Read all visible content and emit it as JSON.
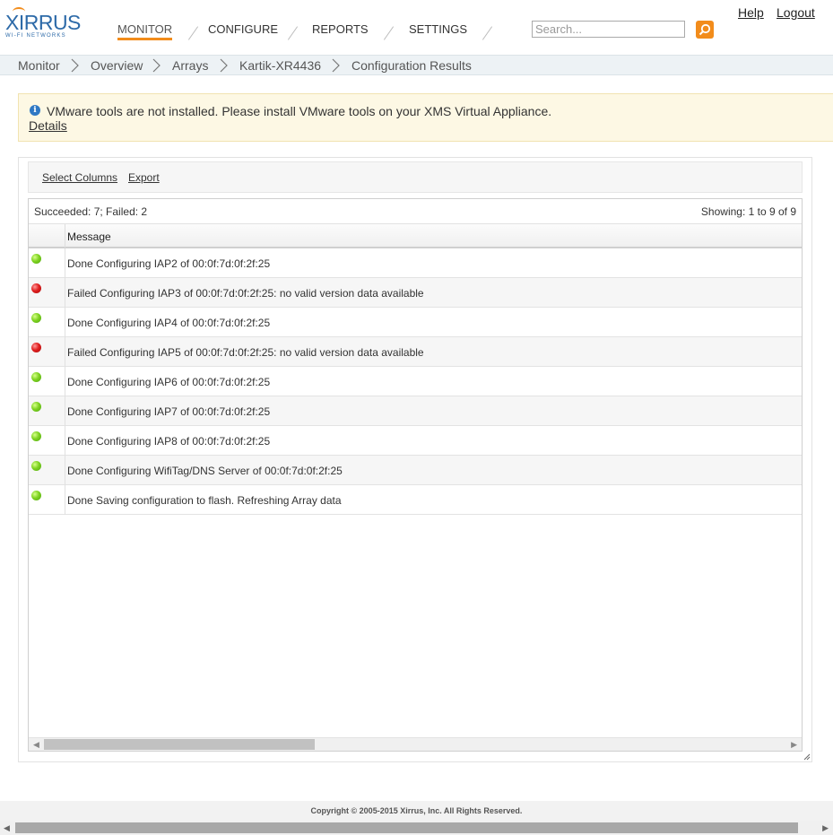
{
  "brand": {
    "name": "XIRRUS",
    "tagline": "WI-FI NETWORKS"
  },
  "nav": {
    "items": [
      {
        "label": "MONITOR",
        "active": true
      },
      {
        "label": "CONFIGURE",
        "active": false
      },
      {
        "label": "REPORTS",
        "active": false
      },
      {
        "label": "SETTINGS",
        "active": false
      }
    ]
  },
  "search": {
    "placeholder": "Search...",
    "value": ""
  },
  "top_links": {
    "help": "Help",
    "logout": "Logout"
  },
  "breadcrumb": [
    "Monitor",
    "Overview",
    "Arrays",
    "Kartik-XR4436",
    "Configuration Results"
  ],
  "alert": {
    "icon": "info-icon",
    "message": "VMware tools are not installed. Please install VMware tools on your XMS Virtual Appliance.",
    "link": "Details"
  },
  "toolbar": {
    "select_columns": "Select Columns",
    "export": "Export"
  },
  "grid": {
    "summary": "Succeeded: 7; Failed: 2",
    "showing": "Showing: 1 to 9 of 9",
    "column_header": "Message",
    "rows": [
      {
        "status": "success",
        "message": "Done Configuring IAP2 of 00:0f:7d:0f:2f:25"
      },
      {
        "status": "failed",
        "message": "Failed Configuring IAP3 of 00:0f:7d:0f:2f:25: no valid version data available"
      },
      {
        "status": "success",
        "message": "Done Configuring IAP4 of 00:0f:7d:0f:2f:25"
      },
      {
        "status": "failed",
        "message": "Failed Configuring IAP5 of 00:0f:7d:0f:2f:25: no valid version data available"
      },
      {
        "status": "success",
        "message": "Done Configuring IAP6 of 00:0f:7d:0f:2f:25"
      },
      {
        "status": "success",
        "message": "Done Configuring IAP7 of 00:0f:7d:0f:2f:25"
      },
      {
        "status": "success",
        "message": "Done Configuring IAP8 of 00:0f:7d:0f:2f:25"
      },
      {
        "status": "success",
        "message": "Done Configuring WifiTag/DNS Server of 00:0f:7d:0f:2f:25"
      },
      {
        "status": "success",
        "message": "Done Saving configuration to flash. Refreshing Array data"
      }
    ]
  },
  "footer": {
    "copyright": "Copyright © 2005-2015 Xirrus, Inc. All Rights Reserved."
  },
  "colors": {
    "accent": "#f28c1b",
    "brand": "#2d6aa8",
    "success": "#6cc417",
    "failed": "#e01f1f"
  }
}
